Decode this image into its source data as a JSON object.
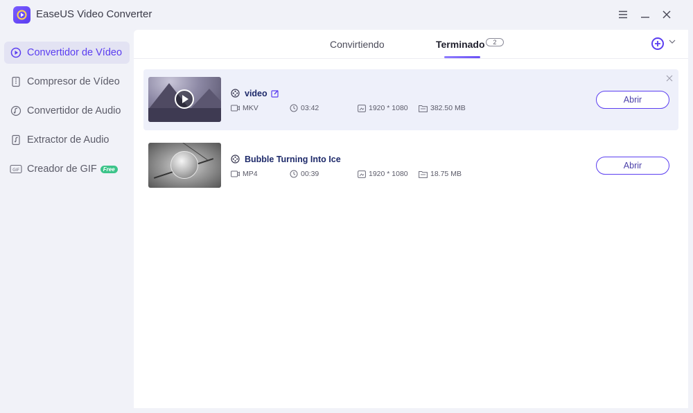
{
  "app": {
    "title": "EaseUS Video Converter"
  },
  "colors": {
    "accent": "#5a3df0",
    "free_badge": "#3cc48a",
    "highlight_row": "#eef0fa"
  },
  "sidebar": {
    "items": [
      {
        "label": "Convertidor de Vídeo",
        "icon": "video-convert-icon",
        "active": true
      },
      {
        "label": "Compresor de Vídeo",
        "icon": "compress-icon",
        "active": false
      },
      {
        "label": "Convertidor de Audio",
        "icon": "audio-convert-icon",
        "active": false
      },
      {
        "label": "Extractor de Audio",
        "icon": "audio-extract-icon",
        "active": false
      },
      {
        "label": "Creador de GIF",
        "icon": "gif-icon",
        "active": false,
        "badge": "Free"
      }
    ]
  },
  "tabs": [
    {
      "label": "Convirtiendo",
      "active": false
    },
    {
      "label": "Terminado",
      "active": true,
      "count": "2"
    }
  ],
  "files": [
    {
      "name": "video",
      "format": "MKV",
      "duration": "03:42",
      "resolution": "1920 * 1080",
      "size": "382.50 MB",
      "open_label": "Abrir",
      "highlighted": true
    },
    {
      "name": "Bubble Turning Into Ice",
      "format": "MP4",
      "duration": "00:39",
      "resolution": "1920 * 1080",
      "size": "18.75 MB",
      "open_label": "Abrir",
      "highlighted": false
    }
  ]
}
